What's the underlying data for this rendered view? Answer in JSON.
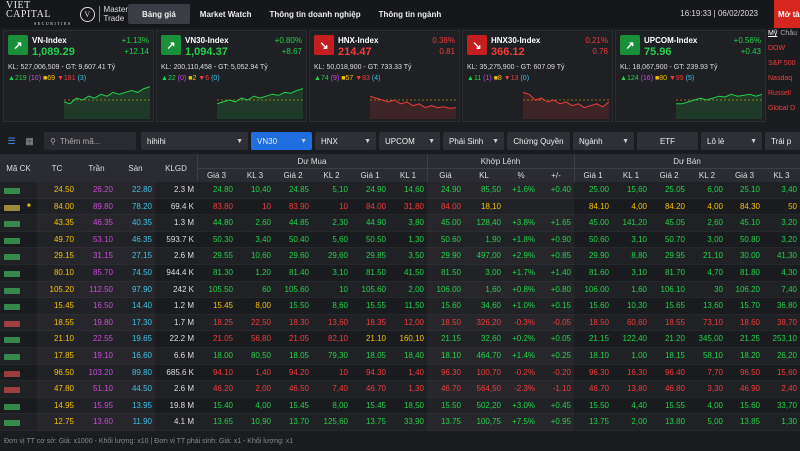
{
  "header": {
    "logo_main": "VIET CAPITAL",
    "logo_sub": "SECURITIES",
    "logo_product_1": "Master",
    "logo_product_2": "Trade",
    "nav": [
      "Bảng giá",
      "Market Watch",
      "Thông tin doanh nghiệp",
      "Thông tin ngành"
    ],
    "time": "16:19:33",
    "date": "06/02/2023",
    "open_account": "Mở tài khoản"
  },
  "indices": [
    {
      "name": "VN-Index",
      "value": "1,089.29",
      "pct": "+1.13%",
      "chg": "+12.14",
      "trend": "up",
      "kl": "KL: 527,006,509 - GT: 9,607.41 Tỷ",
      "adv": "219",
      "ceil": "(10)",
      "ref": "69",
      "dec": "181",
      "floor": "(3)"
    },
    {
      "name": "VN30-Index",
      "value": "1,094.37",
      "pct": "+0.80%",
      "chg": "+8.67",
      "trend": "up",
      "kl": "KL: 200,110,458 - GT: 5,052.94 Tỷ",
      "adv": "22",
      "ceil": "(0)",
      "ref": "2",
      "dec": "6",
      "floor": "(0)"
    },
    {
      "name": "HNX-Index",
      "value": "214.47",
      "pct": "0.38%",
      "chg": "0.81",
      "trend": "down",
      "kl": "KL: 50,018,900 - GT: 733.33 Tỷ",
      "adv": "74",
      "ceil": "(9)",
      "ref": "57",
      "dec": "83",
      "floor": "(4)"
    },
    {
      "name": "HNX30-Index",
      "value": "366.12",
      "pct": "0.21%",
      "chg": "0.76",
      "trend": "down",
      "kl": "KL: 35,275,900 - GT: 607.09 Tỷ",
      "adv": "11",
      "ceil": "(1)",
      "ref": "8",
      "dec": "13",
      "floor": "(0)"
    },
    {
      "name": "UPCOM-Index",
      "value": "75.96",
      "pct": "+0.56%",
      "chg": "+0.43",
      "trend": "up",
      "kl": "KL: 18,067,900 - GT: 239.93 Tỷ",
      "adv": "124",
      "ceil": "(16)",
      "ref": "80",
      "dec": "99",
      "floor": "(5)"
    }
  ],
  "world": {
    "tabs": [
      "Mỹ",
      "Châu"
    ],
    "items": [
      "DOW",
      "S&P 500",
      "Nasdaq",
      "Russell",
      "Global D"
    ]
  },
  "filters": {
    "search_placeholder": "Thêm mã...",
    "watchlist": "hihihi",
    "boards": [
      "VN30",
      "HNX",
      "UPCOM",
      "Phái Sinh",
      "Chứng Quyền",
      "Ngành",
      "ETF",
      "Lô lẻ",
      "Trái p"
    ]
  },
  "table": {
    "groups": [
      "Dư Mua",
      "Khớp Lệnh",
      "Dư Bán"
    ],
    "headers": [
      "Mã CK",
      "TC",
      "Trần",
      "Sàn",
      "KLGD",
      "Giá 3",
      "KL 3",
      "Giá 2",
      "KL 2",
      "Giá 1",
      "KL 1",
      "Giá",
      "KL",
      "%",
      "+/-",
      "Giá 1",
      "KL 1",
      "Giá 2",
      "KL 2",
      "Giá 3",
      "KL 3"
    ],
    "rows": [
      {
        "tc": "24.50",
        "tran": "26.20",
        "san": "22.80",
        "klgd": "2.3 M",
        "b3": "24.80",
        "bk3": "10,40",
        "b2": "24.85",
        "bk2": "5,10",
        "b1": "24.90",
        "bk1": "14,60",
        "p": "24.90",
        "kl": "85,50",
        "pct": "+1.6%",
        "chg": "+0.40",
        "s1": "25.00",
        "sk1": "15,60",
        "s2": "25.05",
        "sk2": "6,00",
        "s3": "25.10",
        "sk3": "3,40",
        "c": [
          "up",
          "up",
          "up",
          "up",
          "up",
          "up",
          "up",
          "up",
          "up",
          "up",
          "up",
          "up"
        ]
      },
      {
        "tc": "84.00",
        "tran": "89.80",
        "san": "78.20",
        "klgd": "69.4 K",
        "b3": "83.80",
        "bk3": "10",
        "b2": "83.90",
        "bk2": "10",
        "b1": "84.00",
        "bk1": "31,80",
        "p": "84.00",
        "kl": "18,10",
        "pct": "",
        "chg": "",
        "s1": "84.10",
        "sk1": "4,00",
        "s2": "84.20",
        "sk2": "4,00",
        "s3": "84.30",
        "sk3": "50",
        "c": [
          "down",
          "down",
          "down",
          "down",
          "ref",
          "ref",
          "ref",
          "ref",
          "ref",
          "up",
          "up",
          "up"
        ],
        "flag": true
      },
      {
        "tc": "43.35",
        "tran": "46.35",
        "san": "40.35",
        "klgd": "1.3 M",
        "b3": "44.80",
        "bk3": "2,60",
        "b2": "44.85",
        "bk2": "2,30",
        "b1": "44.90",
        "bk1": "3,80",
        "p": "45.00",
        "kl": "128,40",
        "pct": "+3.8%",
        "chg": "+1.65",
        "s1": "45.00",
        "sk1": "141,20",
        "s2": "45.05",
        "sk2": "2,60",
        "s3": "45.10",
        "sk3": "3,20",
        "c": [
          "up",
          "up",
          "up",
          "up",
          "up",
          "up",
          "up",
          "up",
          "up",
          "up",
          "up",
          "up"
        ]
      },
      {
        "tc": "49.70",
        "tran": "53.10",
        "san": "46.35",
        "klgd": "593.7 K",
        "b3": "50.30",
        "bk3": "3,40",
        "b2": "50.40",
        "bk2": "5,60",
        "b1": "50.50",
        "bk1": "1,30",
        "p": "50.60",
        "kl": "1,90",
        "pct": "+1.8%",
        "chg": "+0.90",
        "s1": "50.60",
        "sk1": "3,10",
        "s2": "50.70",
        "sk2": "3,00",
        "s3": "50.80",
        "sk3": "3,20",
        "c": [
          "up",
          "up",
          "up",
          "up",
          "up",
          "up",
          "up",
          "up",
          "up",
          "up",
          "up",
          "up"
        ]
      },
      {
        "tc": "29.15",
        "tran": "31.15",
        "san": "27.15",
        "klgd": "2.6 M",
        "b3": "29.55",
        "bk3": "10,60",
        "b2": "29.60",
        "bk2": "29,60",
        "b1": "29.85",
        "bk1": "3,50",
        "p": "29.90",
        "kl": "497,00",
        "pct": "+2.9%",
        "chg": "+0.85",
        "s1": "29.90",
        "sk1": "8,80",
        "s2": "29.95",
        "sk2": "21,10",
        "s3": "30.00",
        "sk3": "41,30",
        "c": [
          "up",
          "up",
          "up",
          "up",
          "up",
          "up",
          "up",
          "up",
          "up",
          "up",
          "up",
          "up"
        ]
      },
      {
        "tc": "80.10",
        "tran": "85.70",
        "san": "74.50",
        "klgd": "944.4 K",
        "b3": "81.30",
        "bk3": "1,20",
        "b2": "81.40",
        "bk2": "3,10",
        "b1": "81.50",
        "bk1": "41,50",
        "p": "81.50",
        "kl": "3,00",
        "pct": "+1.7%",
        "chg": "+1.40",
        "s1": "81.60",
        "sk1": "3,10",
        "s2": "81.70",
        "sk2": "4,70",
        "s3": "81.80",
        "sk3": "4,30",
        "c": [
          "up",
          "up",
          "up",
          "up",
          "up",
          "up",
          "up",
          "up",
          "up",
          "up",
          "up",
          "up"
        ]
      },
      {
        "tc": "105.20",
        "tran": "112.50",
        "san": "97.90",
        "klgd": "242 K",
        "b3": "105.50",
        "bk3": "60",
        "b2": "105.60",
        "bk2": "10",
        "b1": "105.60",
        "bk1": "2,00",
        "p": "106.00",
        "kl": "1,60",
        "pct": "+0.8%",
        "chg": "+0.80",
        "s1": "106.00",
        "sk1": "1,60",
        "s2": "106.10",
        "sk2": "30",
        "s3": "106.20",
        "sk3": "7,40",
        "c": [
          "up",
          "up",
          "up",
          "up",
          "up",
          "up",
          "up",
          "up",
          "up",
          "up",
          "up",
          "up"
        ]
      },
      {
        "tc": "15.45",
        "tran": "16.50",
        "san": "14.40",
        "klgd": "1.2 M",
        "b3": "15.45",
        "bk3": "8,00",
        "b2": "15.50",
        "bk2": "8,60",
        "b1": "15.55",
        "bk1": "11,50",
        "p": "15.60",
        "kl": "34,60",
        "pct": "+1.0%",
        "chg": "+0.15",
        "s1": "15.60",
        "sk1": "10,30",
        "s2": "15.65",
        "sk2": "13,60",
        "s3": "15.70",
        "sk3": "36,80",
        "c": [
          "ref",
          "up",
          "up",
          "up",
          "up",
          "up",
          "up",
          "up",
          "up",
          "up",
          "up",
          "up"
        ]
      },
      {
        "tc": "18.55",
        "tran": "19.80",
        "san": "17.30",
        "klgd": "1.7 M",
        "b3": "18.25",
        "bk3": "22,50",
        "b2": "18.30",
        "bk2": "13,60",
        "b1": "18.35",
        "bk1": "12,00",
        "p": "18.50",
        "kl": "326,20",
        "pct": "-0.3%",
        "chg": "-0.05",
        "s1": "18.50",
        "sk1": "60,60",
        "s2": "18.55",
        "sk2": "73,10",
        "s3": "18.60",
        "sk3": "38,70",
        "c": [
          "down",
          "down",
          "down",
          "down",
          "down",
          "down",
          "down",
          "down",
          "down",
          "ref",
          "up",
          "up"
        ]
      },
      {
        "tc": "21.10",
        "tran": "22.55",
        "san": "19.65",
        "klgd": "22.2 M",
        "b3": "21.05",
        "bk3": "56,80",
        "b2": "21.05",
        "bk2": "82,10",
        "b1": "21.10",
        "bk1": "160,10",
        "p": "21.15",
        "kl": "32,60",
        "pct": "+0.2%",
        "chg": "+0.05",
        "s1": "21.15",
        "sk1": "122,40",
        "s2": "21.20",
        "sk2": "345,00",
        "s3": "21.25",
        "sk3": "253,10",
        "c": [
          "down",
          "down",
          "ref",
          "up",
          "up",
          "up",
          "up",
          "up",
          "up",
          "up",
          "up",
          "up"
        ]
      },
      {
        "tc": "17.85",
        "tran": "19.10",
        "san": "16.60",
        "klgd": "6.6 M",
        "b3": "18.00",
        "bk3": "80,50",
        "b2": "18.05",
        "bk2": "79,30",
        "b1": "18.05",
        "bk1": "18,40",
        "p": "18.10",
        "kl": "464,70",
        "pct": "+1.4%",
        "chg": "+0.25",
        "s1": "18.10",
        "sk1": "1,00",
        "s2": "18.15",
        "sk2": "58,10",
        "s3": "18.20",
        "sk3": "26,20",
        "c": [
          "up",
          "up",
          "up",
          "up",
          "up",
          "up",
          "up",
          "up",
          "up",
          "up",
          "up",
          "up"
        ]
      },
      {
        "tc": "96.50",
        "tran": "103.20",
        "san": "89.80",
        "klgd": "685.6 K",
        "b3": "94.10",
        "bk3": "1,40",
        "b2": "94.20",
        "bk2": "10",
        "b1": "94.30",
        "bk1": "1,40",
        "p": "96.30",
        "kl": "100,70",
        "pct": "-0.2%",
        "chg": "-0.20",
        "s1": "96.30",
        "sk1": "16,30",
        "s2": "96.40",
        "sk2": "7,70",
        "s3": "96.50",
        "sk3": "15,60",
        "c": [
          "down",
          "down",
          "down",
          "down",
          "down",
          "down",
          "down",
          "down",
          "down",
          "ref",
          "ref",
          "ref"
        ]
      },
      {
        "tc": "47.80",
        "tran": "51.10",
        "san": "44.50",
        "klgd": "2.6 M",
        "b3": "46.20",
        "bk3": "2,00",
        "b2": "46.50",
        "bk2": "7,40",
        "b1": "46.70",
        "bk1": "1,30",
        "p": "46.70",
        "kl": "564,50",
        "pct": "-2.3%",
        "chg": "-1.10",
        "s1": "46.70",
        "sk1": "13,80",
        "s2": "46.80",
        "sk2": "3,30",
        "s3": "46.90",
        "sk3": "2,40",
        "c": [
          "down",
          "down",
          "down",
          "down",
          "down",
          "down",
          "down",
          "down",
          "down",
          "down",
          "down",
          "down"
        ]
      },
      {
        "tc": "14.95",
        "tran": "15.95",
        "san": "13.95",
        "klgd": "19.8 M",
        "b3": "15.40",
        "bk3": "4,00",
        "b2": "15.45",
        "bk2": "8,00",
        "b1": "15.45",
        "bk1": "18,50",
        "p": "15.50",
        "kl": "502,20",
        "pct": "+3.0%",
        "chg": "+0.45",
        "s1": "15.50",
        "sk1": "4,40",
        "s2": "15.55",
        "sk2": "4,00",
        "s3": "15.60",
        "sk3": "33,70",
        "c": [
          "up",
          "up",
          "up",
          "up",
          "up",
          "up",
          "up",
          "up",
          "up",
          "up",
          "up",
          "up"
        ]
      },
      {
        "tc": "12.75",
        "tran": "13.60",
        "san": "11.90",
        "klgd": "4.1 M",
        "b3": "13.65",
        "bk3": "10,90",
        "b2": "13.70",
        "bk2": "125,60",
        "b1": "13.75",
        "bk1": "33,90",
        "p": "13.75",
        "kl": "100,75",
        "pct": "+7.5%",
        "chg": "+0.95",
        "s1": "13.75",
        "sk1": "2,00",
        "s2": "13.80",
        "sk2": "5,00",
        "s3": "13.85",
        "sk3": "1,30",
        "c": [
          "up",
          "up",
          "up",
          "up",
          "up",
          "up",
          "up",
          "up",
          "up",
          "up",
          "up",
          "up"
        ]
      }
    ]
  },
  "footer": "Đơn vị TT cơ sở: Giá: x1000 - Khối lượng: x10 | Đơn vị TT phái sinh: Giá: x1 - Khối lượng: x1",
  "colors": {
    "up": "#22d14a",
    "down": "#f23b3b",
    "ref": "#f2c200",
    "ceil": "#c84cd8",
    "floor": "#3ec1e3",
    "accent": "#1f6ee0"
  }
}
